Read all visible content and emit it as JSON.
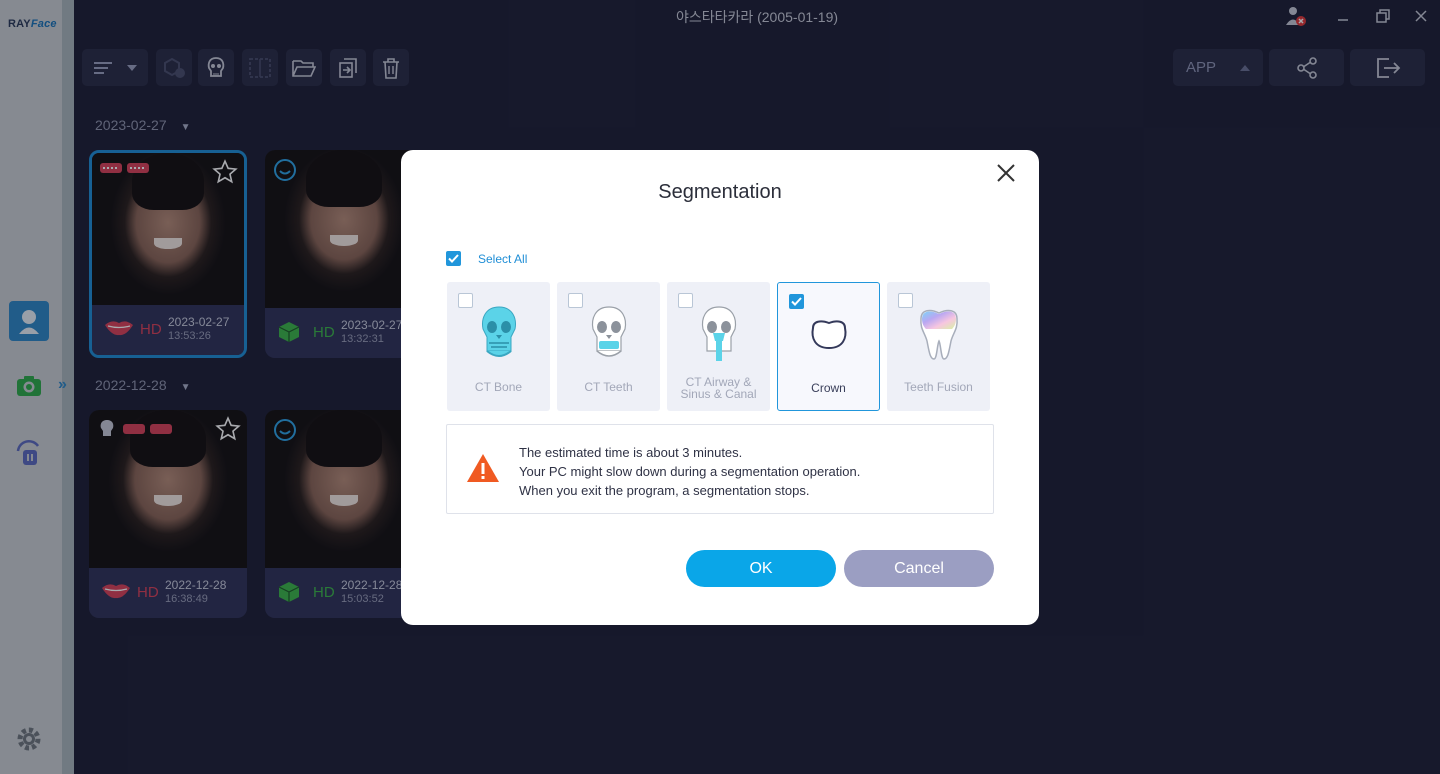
{
  "app": {
    "brand_ray": "RAY",
    "brand_face": "Face",
    "window_title": "야스타타카라 (2005-01-19)"
  },
  "toolbar": {
    "app_label": "APP"
  },
  "groups": [
    {
      "date": "2023-02-27",
      "cards": [
        {
          "hd": "HD",
          "date": "2023-02-27",
          "time": "13:53:26",
          "type": "lips"
        },
        {
          "hd": "HD",
          "date": "2023-02-27",
          "time": "13:32:31",
          "type": "cube"
        }
      ]
    },
    {
      "date": "2022-12-28",
      "cards": [
        {
          "hd": "HD",
          "date": "2022-12-28",
          "time": "16:38:49",
          "type": "lips"
        },
        {
          "hd": "HD",
          "date": "2022-12-28",
          "time": "15:03:52",
          "type": "cube"
        }
      ]
    }
  ],
  "dialog": {
    "title": "Segmentation",
    "select_all": "Select All",
    "options": [
      {
        "label": "CT Bone",
        "checked": false
      },
      {
        "label": "CT Teeth",
        "checked": false
      },
      {
        "label_line1": "CT Airway &",
        "label_line2": "Sinus & Canal",
        "checked": false
      },
      {
        "label": "Crown",
        "checked": true
      },
      {
        "label": "Teeth Fusion",
        "checked": false
      }
    ],
    "info_lines": [
      "The estimated time is about 3 minutes.",
      "Your PC might slow down during a segmentation operation.",
      "When you exit the program, a segmentation stops."
    ],
    "ok": "OK",
    "cancel": "Cancel"
  },
  "colors": {
    "accent": "#0aa6e8",
    "selected_border": "#2196db",
    "cancel": "#9b9ec2",
    "warning": "#f05a22",
    "hd_red": "#d9425a",
    "hd_green": "#3cb54a"
  }
}
